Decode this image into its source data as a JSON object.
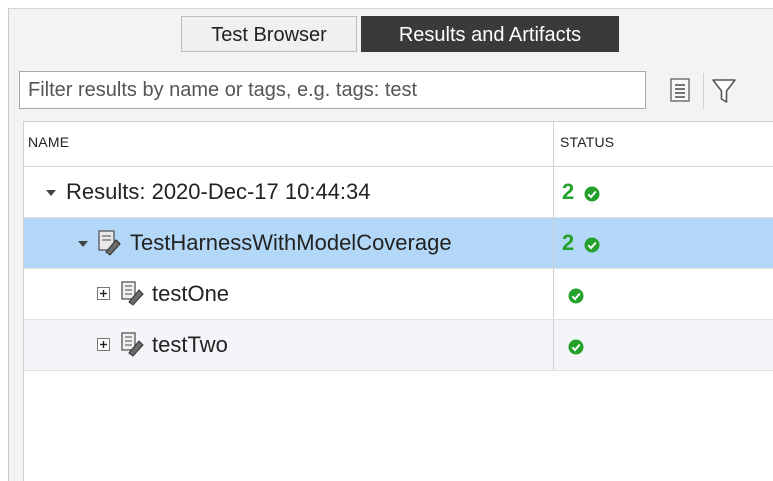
{
  "tabs": [
    {
      "label": "Test Browser",
      "active": false
    },
    {
      "label": "Results and Artifacts",
      "active": true
    }
  ],
  "filter": {
    "placeholder": "Filter results by name or tags, e.g. tags: test",
    "value": ""
  },
  "table": {
    "columns": [
      "NAME",
      "STATUS"
    ],
    "rows": [
      {
        "label": "Results: 2020-Dec-17 10:44:34",
        "count": "2",
        "status": "passed",
        "icon": "none",
        "expanded": true
      },
      {
        "label": "TestHarnessWithModelCoverage",
        "count": "2",
        "status": "passed",
        "icon": "test-file-icon",
        "expanded": true,
        "selected": true
      },
      {
        "label": "testOne",
        "count": "",
        "status": "passed",
        "icon": "test-case-icon",
        "expanded": false
      },
      {
        "label": "testTwo",
        "count": "",
        "status": "passed",
        "icon": "test-case-icon",
        "expanded": false
      }
    ]
  },
  "colors": {
    "active_tab": "#3a3a3a",
    "selected_row": "#b3d8f7",
    "pass": "#23a12b"
  }
}
